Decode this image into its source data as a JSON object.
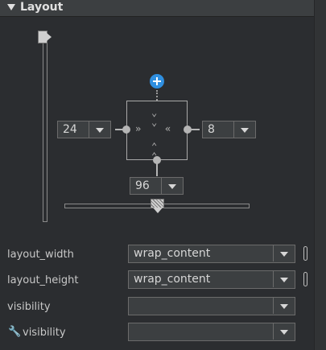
{
  "section": {
    "title": "Layout"
  },
  "inspector": {
    "margin_left": "24",
    "margin_right": "8",
    "margin_bottom": "96"
  },
  "properties": [
    {
      "label": "layout_width",
      "value": "wrap_content"
    },
    {
      "label": "layout_height",
      "value": "wrap_content"
    },
    {
      "label": "visibility",
      "value": ""
    },
    {
      "label": "visibility",
      "value": ""
    }
  ],
  "icons": {
    "collapse": "triangle-down-icon",
    "add_constraint": "plus-circle-icon",
    "tools_attr": "wrench-icon"
  },
  "colors": {
    "accent": "#2f8fe0",
    "panel_bg": "#2b2d30"
  }
}
